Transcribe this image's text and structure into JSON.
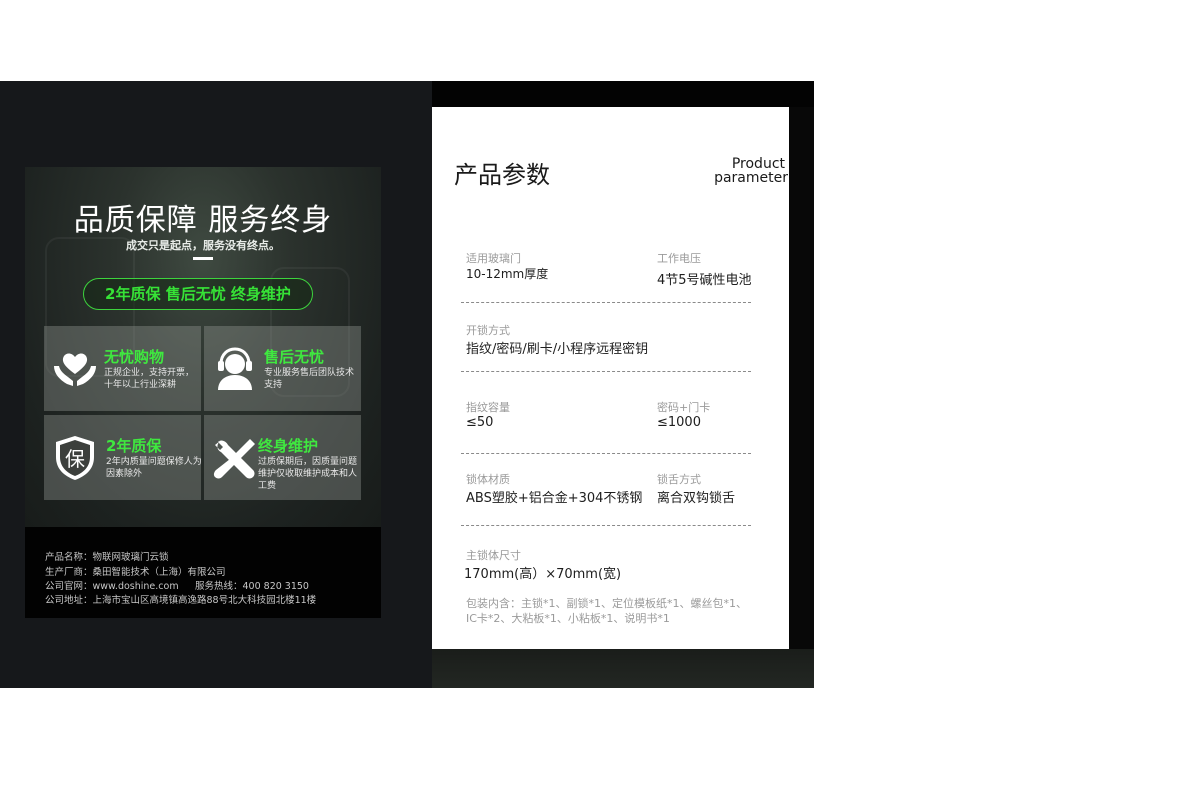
{
  "colors": {
    "accent_green": "#36e236",
    "dark_bg": "#16181b",
    "card_bg": "#767a76"
  },
  "promo": {
    "headline": "品质保障 服务终身",
    "tagline": "成交只是起点，服务没有终点。",
    "pill": "2年质保  售后无忧  终身维护",
    "cards": [
      {
        "icon": "heart-hands-icon",
        "title": "无忧购物",
        "desc": "正规企业，支持开票，十年以上行业深耕"
      },
      {
        "icon": "headset-support-icon",
        "title": "售后无忧",
        "desc": "专业服务售后团队技术支持"
      },
      {
        "icon": "shield-bao-icon",
        "icon_text": "保",
        "title": "2年质保",
        "desc": "2年内质量问题保修人为因素除外"
      },
      {
        "icon": "wrench-screwdriver-icon",
        "title": "终身维护",
        "desc": "过质保期后，因质量问题维护仅收取维护成本和人工费"
      }
    ]
  },
  "company": {
    "product_name": "产品名称：物联网玻璃门云锁",
    "manufacturer": "生产厂商：桑田智能技术（上海）有限公司",
    "website": "公司官网：www.doshine.com",
    "hotline": "服务热线：400 820 3150",
    "address": "公司地址：上海市宝山区高境镇高逸路88号北大科技园北楼11楼"
  },
  "spec": {
    "title": "产品参数",
    "title_en_line1": "Product",
    "title_en_line2": "parameter",
    "items": [
      {
        "label": "适用玻璃门",
        "value": "10-12mm厚度"
      },
      {
        "label": "工作电压",
        "value": "4节5号碱性电池"
      },
      {
        "label": "开锁方式",
        "value": "指纹/密码/刷卡/小程序远程密钥"
      },
      {
        "label": "指纹容量",
        "value": "≤50"
      },
      {
        "label": "密码+门卡",
        "value": "≤1000"
      },
      {
        "label": "锁体材质",
        "value": "ABS塑胶+铝合金+304不锈钢"
      },
      {
        "label": "锁舌方式",
        "value": "离合双钩锁舌"
      },
      {
        "label": "主锁体尺寸",
        "value": "170mm(高）×70mm(宽)"
      }
    ],
    "package_line1": "包装内含：主锁*1、副锁*1、定位模板纸*1、螺丝包*1、",
    "package_line2": "IC卡*2、大粘板*1、小粘板*1、说明书*1"
  }
}
